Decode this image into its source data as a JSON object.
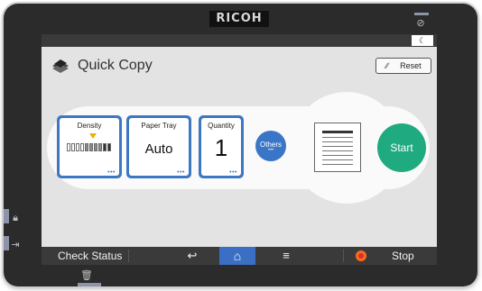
{
  "device": {
    "brand": "RICOH"
  },
  "title": {
    "text": "Quick Copy",
    "icon": "copy-stack-icon"
  },
  "header": {
    "reset_label": "Reset",
    "night_mode_icon": "moon-icon"
  },
  "settings": {
    "density": {
      "label": "Density",
      "level_fraction": 0.6,
      "steps": 10
    },
    "paper_tray": {
      "label": "Paper Tray",
      "value": "Auto"
    },
    "quantity": {
      "label": "Quantity",
      "value": "1"
    },
    "others": {
      "label": "Others"
    }
  },
  "start": {
    "label": "Start"
  },
  "bottombar": {
    "check_status": "Check Status",
    "back_icon": "back-arrow-icon",
    "home_icon": "home-icon",
    "menu_icon": "menu-icon",
    "stop": "Stop"
  },
  "colors": {
    "accent_blue": "#3d77c2",
    "start_green": "#1faa80",
    "stop_orange": "#ff6a1a",
    "density_marker": "#e8b400"
  }
}
